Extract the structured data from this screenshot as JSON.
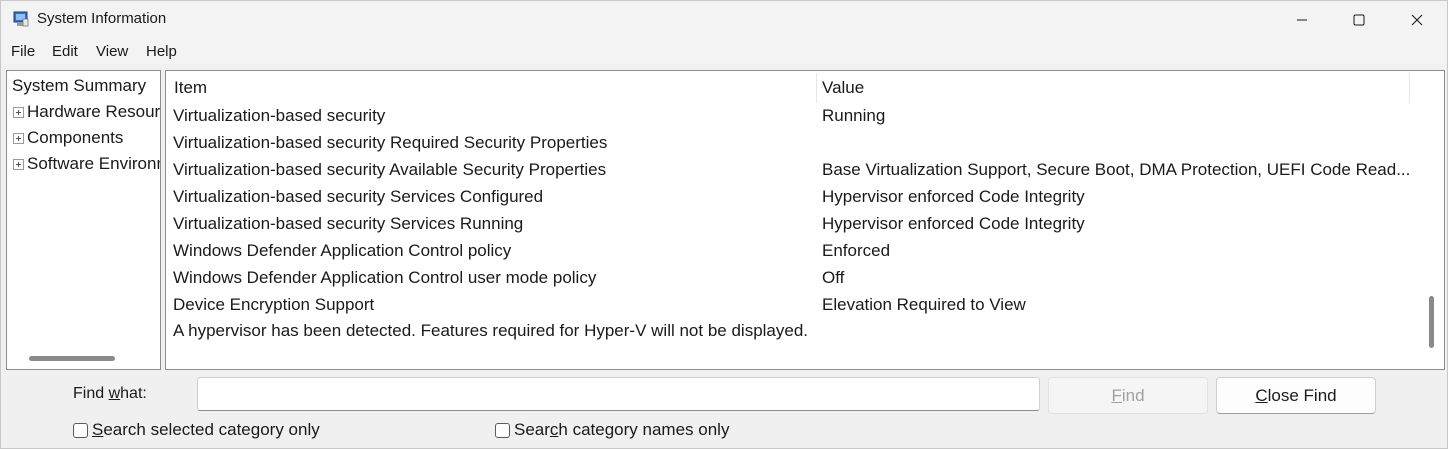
{
  "window": {
    "title": "System Information",
    "controls": {
      "minimize": "minimize-icon",
      "maximize": "maximize-icon",
      "close": "close-icon"
    }
  },
  "menu": [
    "File",
    "Edit",
    "View",
    "Help"
  ],
  "tree": {
    "root": "System Summary",
    "nodes": [
      "Hardware Resources",
      "Components",
      "Software Environment"
    ]
  },
  "list": {
    "columns": [
      "Item",
      "Value"
    ],
    "rows": [
      {
        "item": "Virtualization-based security",
        "value": "Running"
      },
      {
        "item": "Virtualization-based security Required Security Properties",
        "value": ""
      },
      {
        "item": "Virtualization-based security Available Security Properties",
        "value": "Base Virtualization Support, Secure Boot, DMA Protection, UEFI Code Read..."
      },
      {
        "item": "Virtualization-based security Services Configured",
        "value": "Hypervisor enforced Code Integrity"
      },
      {
        "item": "Virtualization-based security Services Running",
        "value": "Hypervisor enforced Code Integrity"
      },
      {
        "item": "Windows Defender Application Control policy",
        "value": "Enforced"
      },
      {
        "item": "Windows Defender Application Control user mode policy",
        "value": "Off"
      },
      {
        "item": "Device Encryption Support",
        "value": "Elevation Required to View"
      }
    ],
    "note": "A hypervisor has been detected. Features required for Hyper-V will not be displayed."
  },
  "find": {
    "label_pre": "Find ",
    "label_u": "w",
    "label_post": "hat:",
    "value": "",
    "find_button_u": "F",
    "find_button_rest": "ind",
    "close_button_u": "C",
    "close_button_rest": "lose Find"
  },
  "options": {
    "selected_only_u": "S",
    "selected_only_rest": "earch selected category only",
    "names_only_pre": "Sear",
    "names_only_u": "c",
    "names_only_post": "h category names only"
  }
}
